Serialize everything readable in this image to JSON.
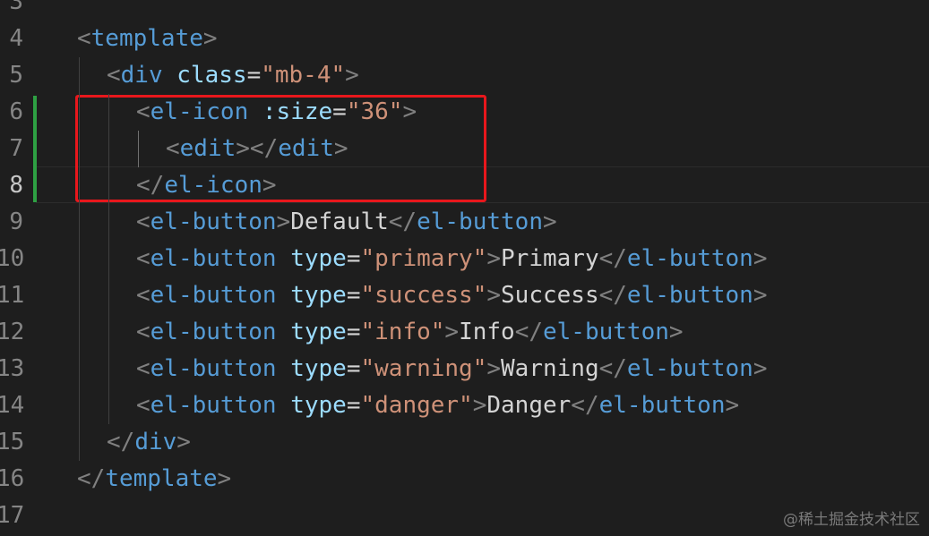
{
  "editor": {
    "line_numbers": [
      "3",
      "4",
      "5",
      "6",
      "7",
      "8",
      "9",
      "10",
      "11",
      "12",
      "13",
      "14",
      "15",
      "16",
      "17"
    ],
    "active_line": "8",
    "lines": [
      {
        "num": "3",
        "indent": 0,
        "tokens": []
      },
      {
        "num": "4",
        "indent": 0,
        "tokens": [
          {
            "t": "punct",
            "v": "<"
          },
          {
            "t": "tag",
            "v": "template"
          },
          {
            "t": "punct",
            "v": ">"
          }
        ]
      },
      {
        "num": "5",
        "indent": 1,
        "tokens": [
          {
            "t": "punct",
            "v": "<"
          },
          {
            "t": "tag",
            "v": "div"
          },
          {
            "t": "text",
            "v": " "
          },
          {
            "t": "attr",
            "v": "class"
          },
          {
            "t": "eq",
            "v": "="
          },
          {
            "t": "str",
            "v": "\"mb-4\""
          },
          {
            "t": "punct",
            "v": ">"
          }
        ]
      },
      {
        "num": "6",
        "indent": 2,
        "tokens": [
          {
            "t": "punct",
            "v": "<"
          },
          {
            "t": "tag",
            "v": "el-icon"
          },
          {
            "t": "text",
            "v": " "
          },
          {
            "t": "attr",
            "v": ":size"
          },
          {
            "t": "eq",
            "v": "="
          },
          {
            "t": "str",
            "v": "\"36\""
          },
          {
            "t": "punct",
            "v": ">"
          }
        ]
      },
      {
        "num": "7",
        "indent": 3,
        "tokens": [
          {
            "t": "punct",
            "v": "<"
          },
          {
            "t": "tag",
            "v": "edit"
          },
          {
            "t": "punct",
            "v": "></"
          },
          {
            "t": "tag",
            "v": "edit"
          },
          {
            "t": "punct",
            "v": ">"
          }
        ]
      },
      {
        "num": "8",
        "indent": 2,
        "tokens": [
          {
            "t": "punct",
            "v": "</"
          },
          {
            "t": "tag",
            "v": "el-icon"
          },
          {
            "t": "punct",
            "v": ">"
          }
        ]
      },
      {
        "num": "9",
        "indent": 2,
        "tokens": [
          {
            "t": "punct",
            "v": "<"
          },
          {
            "t": "tag",
            "v": "el-button"
          },
          {
            "t": "punct",
            "v": ">"
          },
          {
            "t": "text",
            "v": "Default"
          },
          {
            "t": "punct",
            "v": "</"
          },
          {
            "t": "tag",
            "v": "el-button"
          },
          {
            "t": "punct",
            "v": ">"
          }
        ]
      },
      {
        "num": "10",
        "indent": 2,
        "tokens": [
          {
            "t": "punct",
            "v": "<"
          },
          {
            "t": "tag",
            "v": "el-button"
          },
          {
            "t": "text",
            "v": " "
          },
          {
            "t": "attr",
            "v": "type"
          },
          {
            "t": "eq",
            "v": "="
          },
          {
            "t": "str",
            "v": "\"primary\""
          },
          {
            "t": "punct",
            "v": ">"
          },
          {
            "t": "text",
            "v": "Primary"
          },
          {
            "t": "punct",
            "v": "</"
          },
          {
            "t": "tag",
            "v": "el-button"
          },
          {
            "t": "punct",
            "v": ">"
          }
        ]
      },
      {
        "num": "11",
        "indent": 2,
        "tokens": [
          {
            "t": "punct",
            "v": "<"
          },
          {
            "t": "tag",
            "v": "el-button"
          },
          {
            "t": "text",
            "v": " "
          },
          {
            "t": "attr",
            "v": "type"
          },
          {
            "t": "eq",
            "v": "="
          },
          {
            "t": "str",
            "v": "\"success\""
          },
          {
            "t": "punct",
            "v": ">"
          },
          {
            "t": "text",
            "v": "Success"
          },
          {
            "t": "punct",
            "v": "</"
          },
          {
            "t": "tag",
            "v": "el-button"
          },
          {
            "t": "punct",
            "v": ">"
          }
        ]
      },
      {
        "num": "12",
        "indent": 2,
        "tokens": [
          {
            "t": "punct",
            "v": "<"
          },
          {
            "t": "tag",
            "v": "el-button"
          },
          {
            "t": "text",
            "v": " "
          },
          {
            "t": "attr",
            "v": "type"
          },
          {
            "t": "eq",
            "v": "="
          },
          {
            "t": "str",
            "v": "\"info\""
          },
          {
            "t": "punct",
            "v": ">"
          },
          {
            "t": "text",
            "v": "Info"
          },
          {
            "t": "punct",
            "v": "</"
          },
          {
            "t": "tag",
            "v": "el-button"
          },
          {
            "t": "punct",
            "v": ">"
          }
        ]
      },
      {
        "num": "13",
        "indent": 2,
        "tokens": [
          {
            "t": "punct",
            "v": "<"
          },
          {
            "t": "tag",
            "v": "el-button"
          },
          {
            "t": "text",
            "v": " "
          },
          {
            "t": "attr",
            "v": "type"
          },
          {
            "t": "eq",
            "v": "="
          },
          {
            "t": "str",
            "v": "\"warning\""
          },
          {
            "t": "punct",
            "v": ">"
          },
          {
            "t": "text",
            "v": "Warning"
          },
          {
            "t": "punct",
            "v": "</"
          },
          {
            "t": "tag",
            "v": "el-button"
          },
          {
            "t": "punct",
            "v": ">"
          }
        ]
      },
      {
        "num": "14",
        "indent": 2,
        "tokens": [
          {
            "t": "punct",
            "v": "<"
          },
          {
            "t": "tag",
            "v": "el-button"
          },
          {
            "t": "text",
            "v": " "
          },
          {
            "t": "attr",
            "v": "type"
          },
          {
            "t": "eq",
            "v": "="
          },
          {
            "t": "str",
            "v": "\"danger\""
          },
          {
            "t": "punct",
            "v": ">"
          },
          {
            "t": "text",
            "v": "Danger"
          },
          {
            "t": "punct",
            "v": "</"
          },
          {
            "t": "tag",
            "v": "el-button"
          },
          {
            "t": "punct",
            "v": ">"
          }
        ]
      },
      {
        "num": "15",
        "indent": 1,
        "tokens": [
          {
            "t": "punct",
            "v": "</"
          },
          {
            "t": "tag",
            "v": "div"
          },
          {
            "t": "punct",
            "v": ">"
          }
        ]
      },
      {
        "num": "16",
        "indent": 0,
        "tokens": [
          {
            "t": "punct",
            "v": "</"
          },
          {
            "t": "tag",
            "v": "template"
          },
          {
            "t": "punct",
            "v": ">"
          }
        ]
      },
      {
        "num": "17",
        "indent": 0,
        "tokens": []
      }
    ]
  },
  "theme": {
    "background": "#1e1e1e",
    "tag": "#569cd6",
    "attribute": "#9cdcfe",
    "string": "#ce9178",
    "text": "#d4d4d4",
    "punctuation": "#808080",
    "highlight_box": "#e8171c",
    "git_modified": "#2ea043"
  },
  "annotations": {
    "highlight_box_label": "red box around el-icon block (lines 6-8)"
  },
  "watermark": "@稀土掘金技术社区"
}
